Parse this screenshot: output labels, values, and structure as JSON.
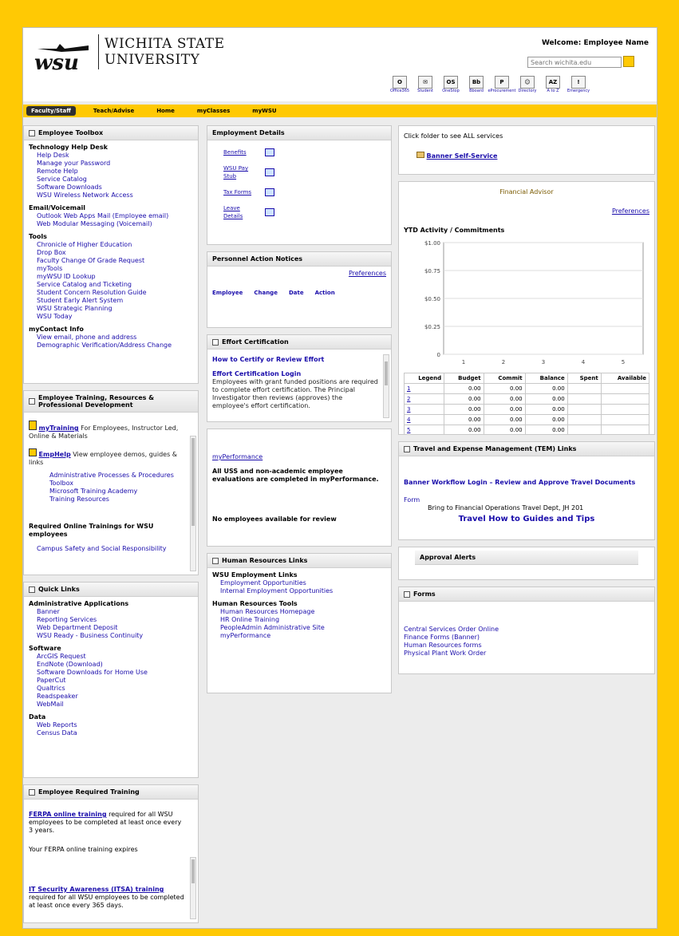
{
  "header": {
    "university_line1": "WICHITA STATE",
    "university_line2": "UNIVERSITY",
    "logo_letters": "wsu",
    "welcome": "Welcome: Employee Name",
    "search_placeholder": "Search wichita.edu",
    "apps": [
      {
        "icon": "office-icon",
        "glyph": "O",
        "label": "Office365"
      },
      {
        "icon": "mail-icon",
        "glyph": "✉",
        "label": "Student"
      },
      {
        "icon": "onestop-icon",
        "glyph": "OS",
        "label": "OneStop"
      },
      {
        "icon": "blackboard-icon",
        "glyph": "Bb",
        "label": "Bboard"
      },
      {
        "icon": "procurement-icon",
        "glyph": "P",
        "label": "eProcurement"
      },
      {
        "icon": "directory-icon",
        "glyph": "☺",
        "label": "Directory"
      },
      {
        "icon": "atoz-icon",
        "glyph": "AZ",
        "label": "A to Z"
      },
      {
        "icon": "emergency-icon",
        "glyph": "!",
        "label": "Emergency"
      }
    ]
  },
  "nav": {
    "tabs": [
      "Faculty/Staff",
      "Teach/Advise",
      "Home",
      "myClasses",
      "myWSU"
    ]
  },
  "toolbox": {
    "title": "Employee Toolbox",
    "sections": [
      {
        "heading": "Technology Help Desk",
        "links": [
          "Help Desk",
          "Manage your Password",
          "Remote Help",
          "Service Catalog",
          "Software Downloads",
          "WSU Wireless Network Access"
        ]
      },
      {
        "heading": "Email/Voicemail",
        "links": [
          "Outlook Web Apps Mail (Employee email)",
          "Web Modular Messaging (Voicemail)"
        ]
      },
      {
        "heading": "Tools",
        "links": [
          "Chronicle of Higher Education",
          "Drop Box",
          "Faculty Change Of Grade Request",
          "myTools",
          "myWSU ID Lookup",
          "Service Catalog and Ticketing",
          "Student Concern Resolution Guide",
          "Student Early Alert System",
          "WSU Strategic Planning",
          "WSU Today"
        ]
      },
      {
        "heading": "myContact Info",
        "links": [
          "View email, phone and address",
          "Demographic Verification/Address Change"
        ]
      }
    ]
  },
  "training": {
    "title": "Employee Training, Resources & Professional Development",
    "mytraining_link": "myTraining",
    "mytraining_text": "For Employees, Instructor Led, Online & Materials",
    "emphelp_link": "EmpHelp",
    "emphelp_text": "View employee demos, guides & links",
    "bullets": [
      "Administrative Processes & Procedures Toolbox",
      "Microsoft Training Academy",
      "Training Resources"
    ],
    "required_heading": "Required Online Trainings for WSU employees",
    "required_link": "Campus Safety and Social Responsibility"
  },
  "quicklinks": {
    "title": "Quick Links",
    "sections": [
      {
        "heading": "Administrative Applications",
        "links": [
          "Banner",
          "Reporting Services",
          "Web Department Deposit",
          "WSU Ready - Business Continuity"
        ]
      },
      {
        "heading": "Software",
        "links": [
          "ArcGIS Request",
          "EndNote (Download)",
          "Software Downloads for Home Use",
          "PaperCut",
          "Qualtrics",
          "Readspeaker",
          "WebMail"
        ]
      },
      {
        "heading": "Data",
        "links": [
          "Web Reports",
          "Census Data"
        ]
      }
    ]
  },
  "reqtraining": {
    "title": "Employee Required Training",
    "ferpa_link": "FERPA online training",
    "ferpa_text": "required for all WSU employees to be completed at least once every 3 years.",
    "ferpa_expire": "Your FERPA online training expires",
    "itsa_link": "IT Security Awareness (ITSA) training",
    "itsa_text": "required for all WSU employees to be completed at least once every 365 days."
  },
  "employment": {
    "title": "Employment Details",
    "links": [
      "Benefits",
      "WSU Pay Stub",
      "Tax Forms",
      "Leave Details"
    ]
  },
  "pan": {
    "title": "Personnel Action Notices",
    "preferences": "Preferences",
    "cols": [
      "Employee",
      "Change",
      "Date",
      "Action"
    ]
  },
  "effort": {
    "title": "Effort Certification",
    "link1": "How to Certify or Review Effort",
    "link2": "Effort Certification Login",
    "text": "Employees with grant funded positions are required to complete effort certification. The Principal Investigator then reviews (approves) the employee's effort certification."
  },
  "perf": {
    "link": "myPerformance",
    "text": "All USS and non-academic employee evaluations are completed in myPerformance.",
    "none": "No employees available for review"
  },
  "hr": {
    "title": "Human Resources Links",
    "sec1": "WSU Employment Links",
    "links1": [
      "Employment Opportunities",
      "Internal Employment Opportunities"
    ],
    "sec2": "Human Resources Tools",
    "links2": [
      "Human Resources Homepage",
      "HR Online Training",
      "PeopleAdmin Administrative Site",
      "myPerformance"
    ]
  },
  "banner": {
    "text": "Click folder to see ALL services",
    "link": "Banner Self-Service"
  },
  "finance": {
    "title": "Financial Advisor",
    "preferences": "Preferences",
    "chart_title": "YTD Activity / Commitments",
    "table_cols": [
      "Legend",
      "Budget",
      "Commit",
      "Balance",
      "Spent",
      "Available"
    ],
    "table_rows": [
      [
        "1",
        "0.00",
        "0.00",
        "0.00"
      ],
      [
        "2",
        "0.00",
        "0.00",
        "0.00"
      ],
      [
        "3",
        "0.00",
        "0.00",
        "0.00"
      ],
      [
        "4",
        "0.00",
        "0.00",
        "0.00"
      ],
      [
        "5",
        "0.00",
        "0.00",
        "0.00"
      ]
    ]
  },
  "chart_data": {
    "type": "bar",
    "title": "YTD Activity / Commitments",
    "categories": [
      "1",
      "2",
      "3",
      "4",
      "5"
    ],
    "values": [
      0,
      0,
      0,
      0,
      0
    ],
    "ylim": [
      0,
      1
    ],
    "yticks": [
      "$1.00",
      "$0.75",
      "$0.50",
      "$0.25",
      "0"
    ],
    "grid": true
  },
  "tem": {
    "title": "Travel and Expense Management (TEM) Links",
    "links": [
      "Banner Workflow Login – Review and Approve Travel Documents"
    ],
    "form_label": "Form",
    "form_text": "Bring to Financial Operations Travel Dept, JH 201",
    "guides": "Travel How to Guides and Tips"
  },
  "approval": {
    "title": "Approval Alerts"
  },
  "forms": {
    "title": "Forms",
    "links": [
      "Central Services Order Online",
      "Finance Forms (Banner)",
      "Human Resources forms",
      "Physical Plant Work Order"
    ]
  },
  "colors": {
    "gold": "#ffc904",
    "link": "#1a0dab",
    "dark": "#2f2f2f"
  }
}
